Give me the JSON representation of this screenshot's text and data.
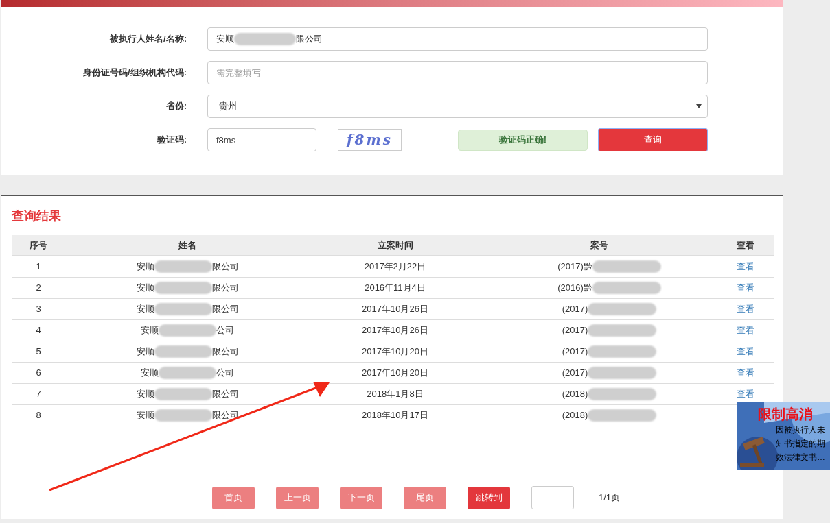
{
  "form": {
    "fields": [
      {
        "kind": "text",
        "label": "被执行人姓名/名称:",
        "value_start": "安顺",
        "value_end": "限公司"
      },
      {
        "kind": "text",
        "label": "身份证号码/组织机构代码:",
        "placeholder": "需完整填写"
      },
      {
        "kind": "select",
        "label": "省份:",
        "value": "贵州"
      },
      {
        "kind": "captcha",
        "label": "验证码:",
        "value": "f8ms",
        "captcha": "f8ms",
        "message": "验证码正确!"
      }
    ],
    "submit": "查询"
  },
  "results": {
    "title": "查询结果",
    "columns": [
      "序号",
      "姓名",
      "立案时间",
      "案号",
      "查看"
    ],
    "rows": [
      {
        "no": "1",
        "name_start": "安顺",
        "name_end": "限公司",
        "date": "2017年2月22日",
        "case": "(2017)黔",
        "view": "查看"
      },
      {
        "no": "2",
        "name_start": "安顺",
        "name_end": "限公司",
        "date": "2016年11月4日",
        "case": "(2016)黔",
        "view": "查看"
      },
      {
        "no": "3",
        "name_start": "安顺",
        "name_end": "限公司",
        "date": "2017年10月26日",
        "case": "(2017)",
        "view": "查看"
      },
      {
        "no": "4",
        "name_start": "安顺",
        "name_end": "公司",
        "date": "2017年10月26日",
        "case": "(2017)",
        "view": "查看"
      },
      {
        "no": "5",
        "name_start": "安顺",
        "name_end": "限公司",
        "date": "2017年10月20日",
        "case": "(2017)",
        "view": "查看"
      },
      {
        "no": "6",
        "name_start": "安顺",
        "name_end": "公司",
        "date": "2017年10月20日",
        "case": "(2017)",
        "view": "查看"
      },
      {
        "no": "7",
        "name_start": "安顺",
        "name_end": "限公司",
        "date": "2018年1月8日",
        "case": "(2018)",
        "view": "查看"
      },
      {
        "no": "8",
        "name_start": "安顺",
        "name_end": "限公司",
        "date": "2018年10月17日",
        "case": "(2018)"
      }
    ]
  },
  "pagination": {
    "buttons": [
      {
        "label": "首页",
        "kind": "nav"
      },
      {
        "label": "上一页",
        "kind": "nav"
      },
      {
        "label": "下一页",
        "kind": "nav"
      },
      {
        "label": "尾页",
        "kind": "nav"
      },
      {
        "label": "跳转到",
        "kind": "go"
      }
    ],
    "page_info": "1/1页"
  },
  "ad": {
    "title": "限制高消",
    "lines": [
      "因被执行人未",
      "知书指定的期",
      "效法律文书…"
    ]
  }
}
